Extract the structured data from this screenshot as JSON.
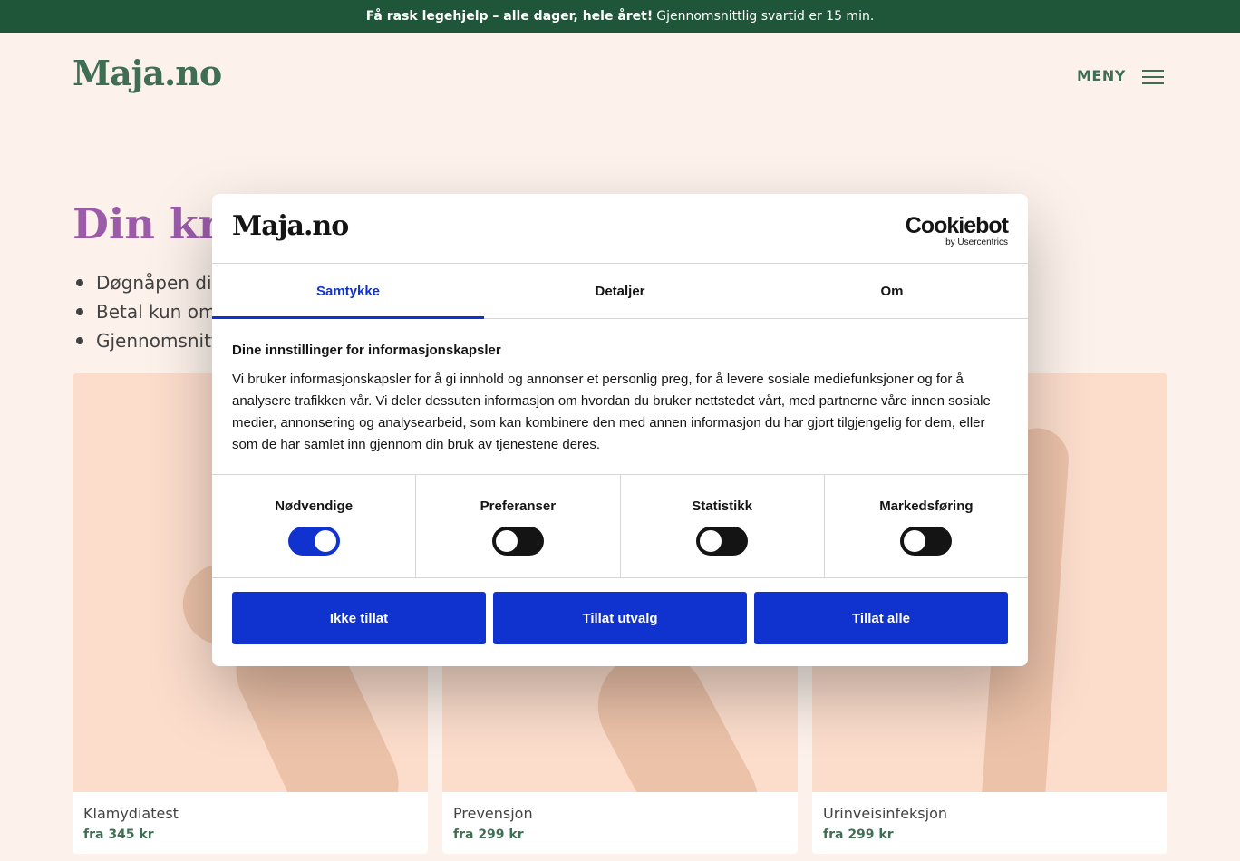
{
  "topbar": {
    "bold_text": "Få rask legehjelp – alle dager, hele året!",
    "text": "Gjennomsnittlig svartid er 15 min."
  },
  "header": {
    "logo": "Maja.no",
    "menu_label": "MENY"
  },
  "hero": {
    "title": "Din kro",
    "bullets": [
      "Døgnåpen dig",
      "Betal kun om",
      "Gjennomsnitt"
    ]
  },
  "cards": [
    {
      "name": "Klamydiatest",
      "price": "fra 345 kr"
    },
    {
      "name": "Prevensjon",
      "price": "fra 299 kr"
    },
    {
      "name": "Urinveisinfeksjon",
      "price": "fra 299 kr"
    }
  ],
  "cookie_dialog": {
    "logo": "Maja.no",
    "provider": {
      "name": "Cookiebot",
      "by": "by Usercentrics"
    },
    "tabs": [
      {
        "label": "Samtykke",
        "active": true
      },
      {
        "label": "Detaljer",
        "active": false
      },
      {
        "label": "Om",
        "active": false
      }
    ],
    "heading": "Dine innstillinger for informasjonskapsler",
    "body": "Vi bruker informasjonskapsler for å gi innhold og annonser et personlig preg, for å levere sosiale mediefunksjoner og for å analysere trafikken vår. Vi deler dessuten informasjon om hvordan du bruker nettstedet vårt, med partnerne våre innen sosiale medier, annonsering og analysearbeid, som kan kombinere den med annen informasjon du har gjort tilgjengelig for dem, eller som de har samlet inn gjennom din bruk av tjenestene deres.",
    "toggles": [
      {
        "label": "Nødvendige",
        "on": true
      },
      {
        "label": "Preferanser",
        "on": false
      },
      {
        "label": "Statistikk",
        "on": false
      },
      {
        "label": "Markedsføring",
        "on": false
      }
    ],
    "buttons": {
      "deny": "Ikke tillat",
      "selection": "Tillat utvalg",
      "all": "Tillat alle"
    },
    "accent_color": "#1032cf"
  },
  "colors": {
    "brand_green": "#1f5538",
    "hero_purple": "#8a3f9a",
    "background": "#fdf0e8"
  }
}
